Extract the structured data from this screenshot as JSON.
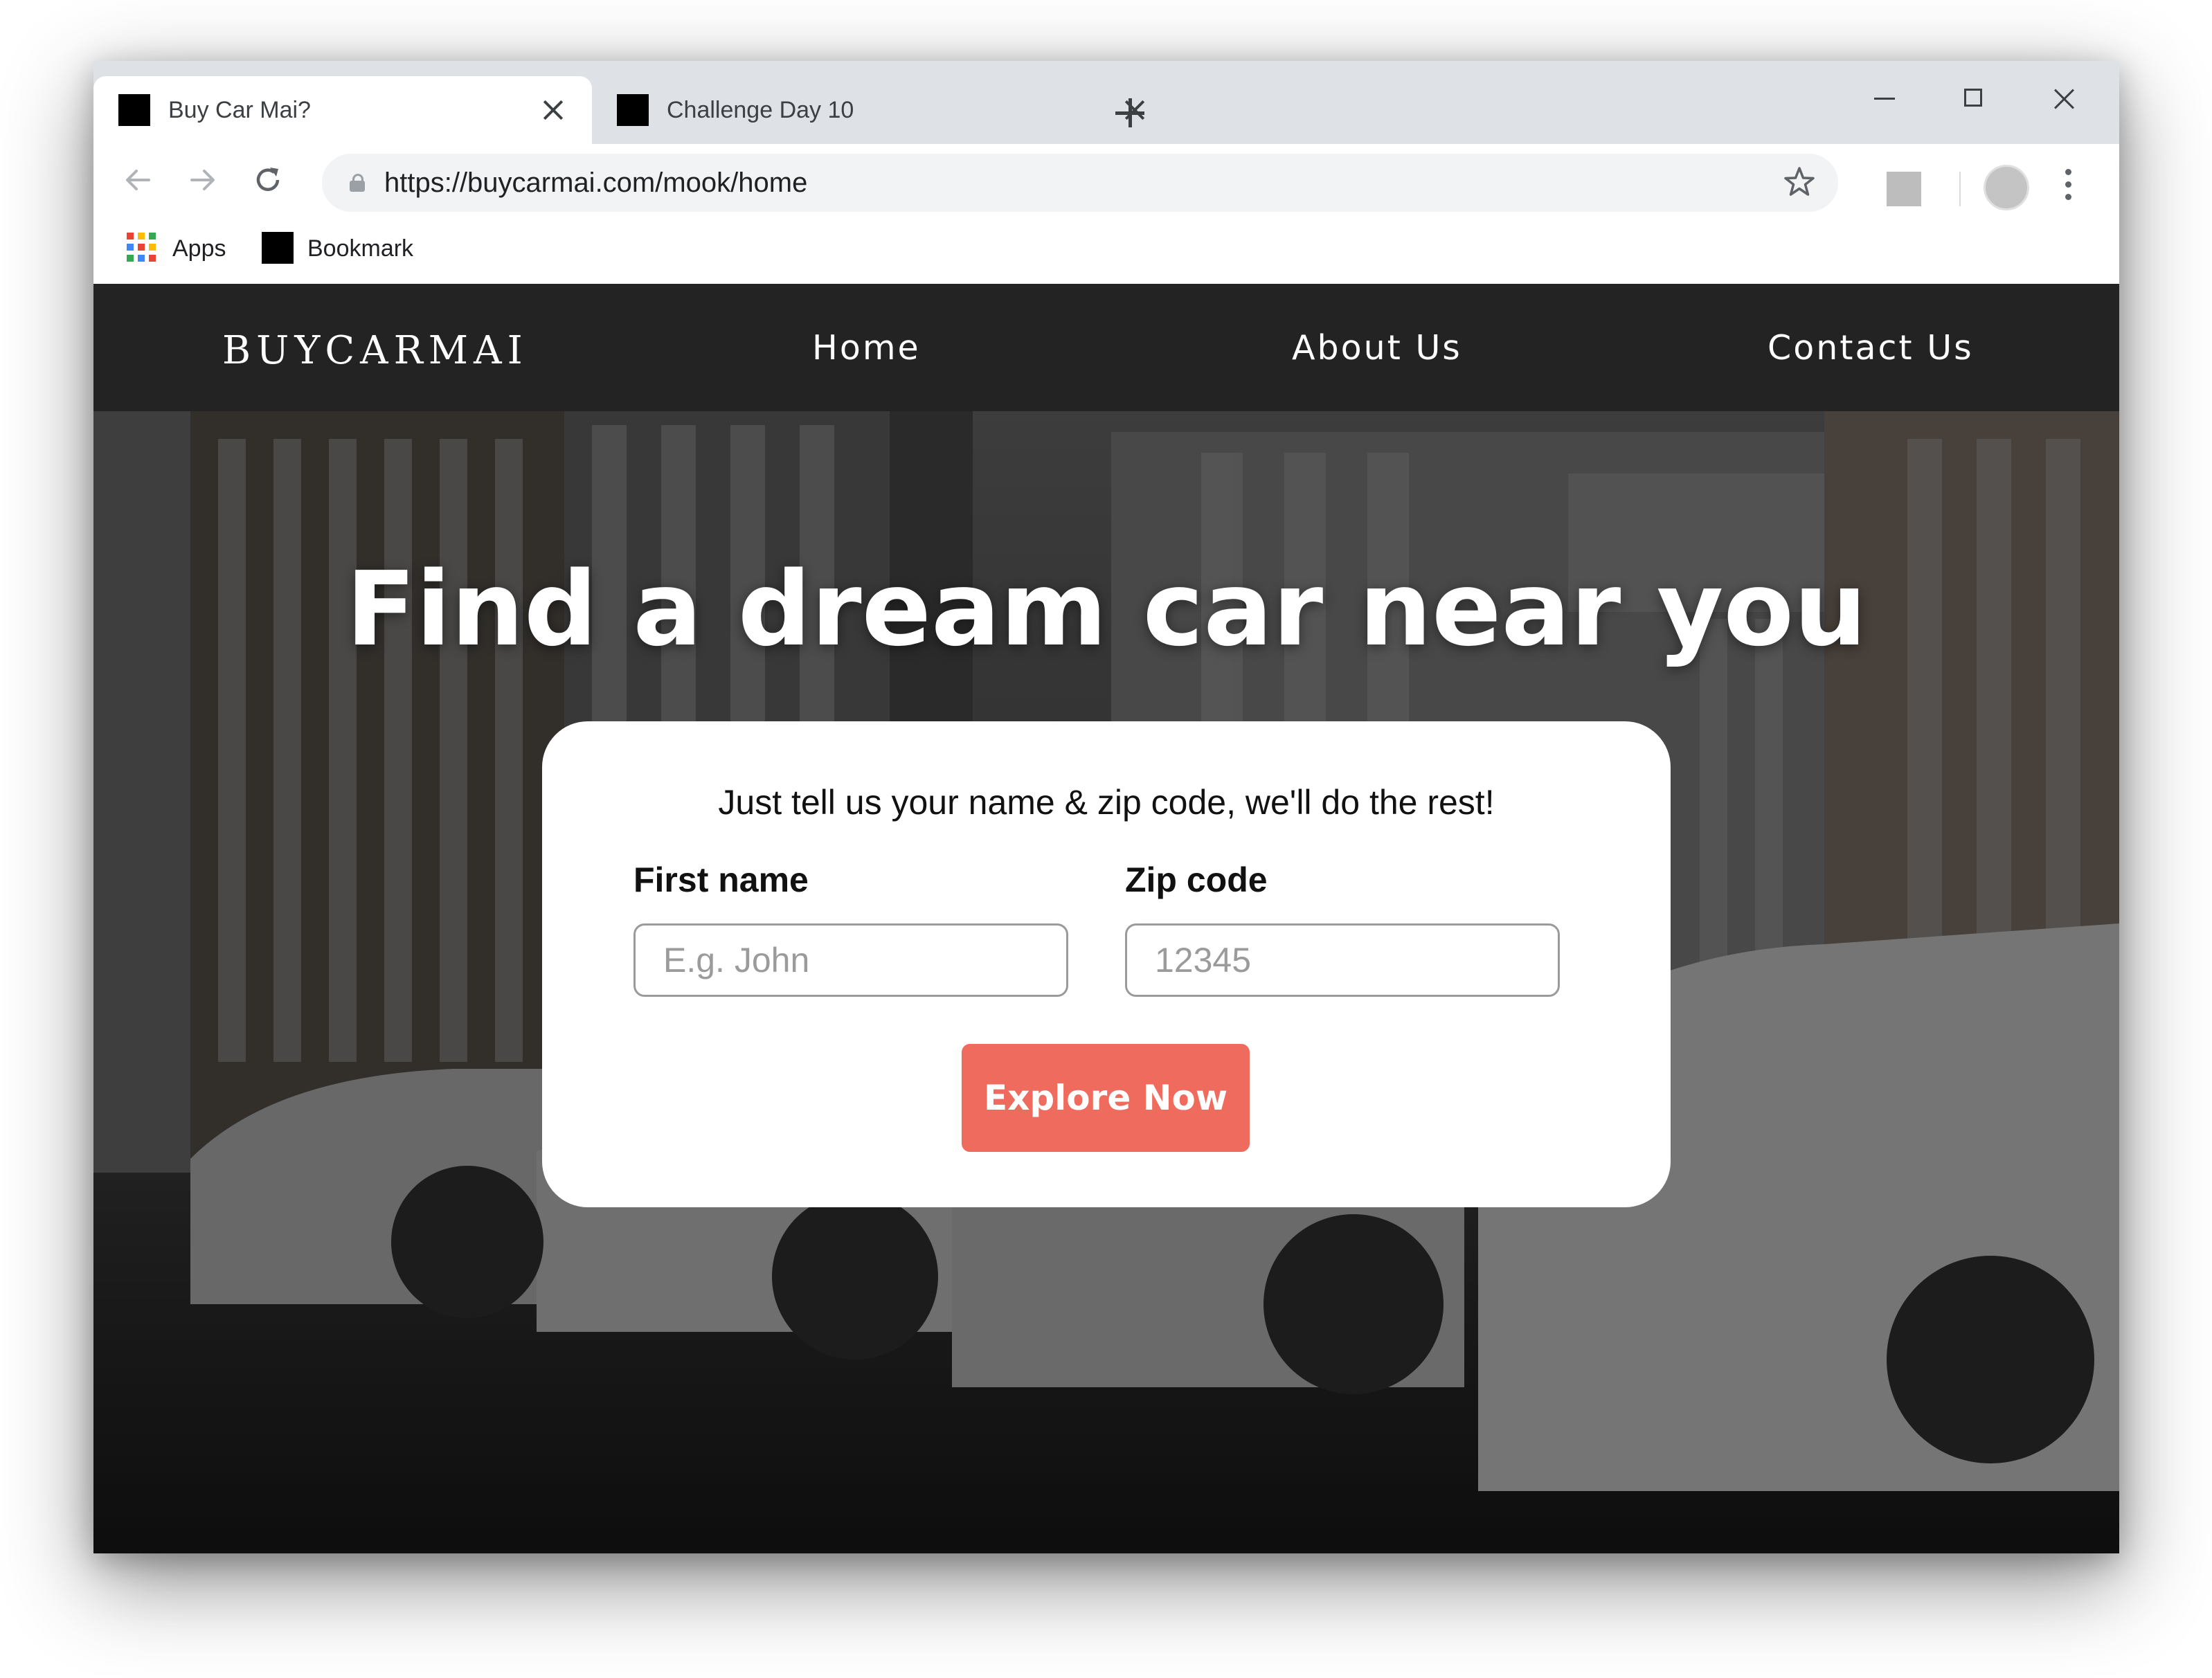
{
  "browser": {
    "tabs": [
      {
        "title": "Buy Car Mai?",
        "active": true
      },
      {
        "title": "Challenge Day 10",
        "active": false
      }
    ],
    "url": "https://buycarmai.com/mook/home",
    "bookmarks": [
      {
        "label": "Apps",
        "icon": "apps-grid-icon"
      },
      {
        "label": "Bookmark",
        "icon": "bookmark-favicon"
      }
    ]
  },
  "site": {
    "logo": "BUYCARMAI",
    "nav": [
      "Home",
      "About Us",
      "Contact Us"
    ],
    "hero_title": "Find a dream car near you",
    "form": {
      "subtitle": "Just tell us your name & zip code, we'll do the rest!",
      "first_name_label": "First name",
      "first_name_placeholder": "E.g. John",
      "zip_label": "Zip code",
      "zip_placeholder": "12345",
      "cta_label": "Explore Now"
    }
  },
  "colors": {
    "nav_bg": "#232323",
    "cta": "#ee6b5e",
    "tabstrip": "#dee1e6",
    "omnibox": "#f1f3f4"
  }
}
